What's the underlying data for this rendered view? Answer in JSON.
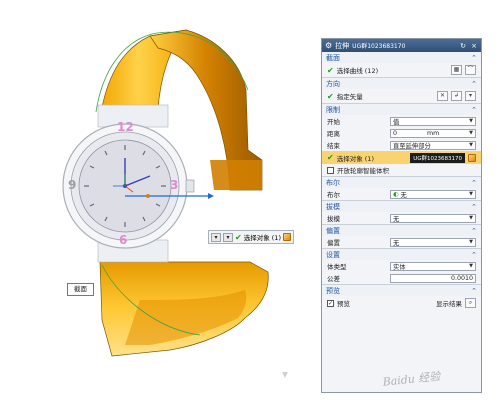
{
  "dialog": {
    "title": "拉伸",
    "part_name": "UG群1023683170",
    "sections": {
      "section": {
        "title": "截面",
        "select_curve": "选择曲线 (12)"
      },
      "direction": {
        "title": "方向",
        "specify_vector": "指定矢量"
      },
      "limits": {
        "title": "限制",
        "start_label": "开始",
        "start_value": "值",
        "distance_label": "距离",
        "distance_value": "0",
        "distance_unit": "mm",
        "end_label": "结束",
        "end_value": "直至延伸部分",
        "select_object": "选择对象 (1)",
        "tooltip": "UG群1023683170",
        "open_profile": "开放轮廓智能体积"
      },
      "boolean": {
        "title": "布尔",
        "label": "布尔",
        "value": "无"
      },
      "draft": {
        "title": "拔模",
        "label": "拔模",
        "value": "无"
      },
      "offset": {
        "title": "偏置",
        "label": "偏置",
        "value": "无"
      },
      "settings": {
        "title": "设置",
        "body_type_label": "体类型",
        "body_type_value": "实体",
        "tolerance_label": "公差",
        "tolerance_value": "0.0010"
      },
      "preview": {
        "title": "预览",
        "preview_label": "预览",
        "show_result": "显示结果"
      }
    }
  },
  "viewport": {
    "inline_select": "选择对象 (1)",
    "section_label": "截面",
    "dial_numbers": [
      "12",
      "3",
      "6",
      "9"
    ]
  },
  "watermark": "Baidu 经验",
  "colors": {
    "band_light": "#ffd35a",
    "band_dark": "#c07a00",
    "title_bar": "#3a5a84",
    "group_title": "#1f55a6",
    "highlight_row": "#f8d36f",
    "check_green": "#1e9c1e"
  }
}
